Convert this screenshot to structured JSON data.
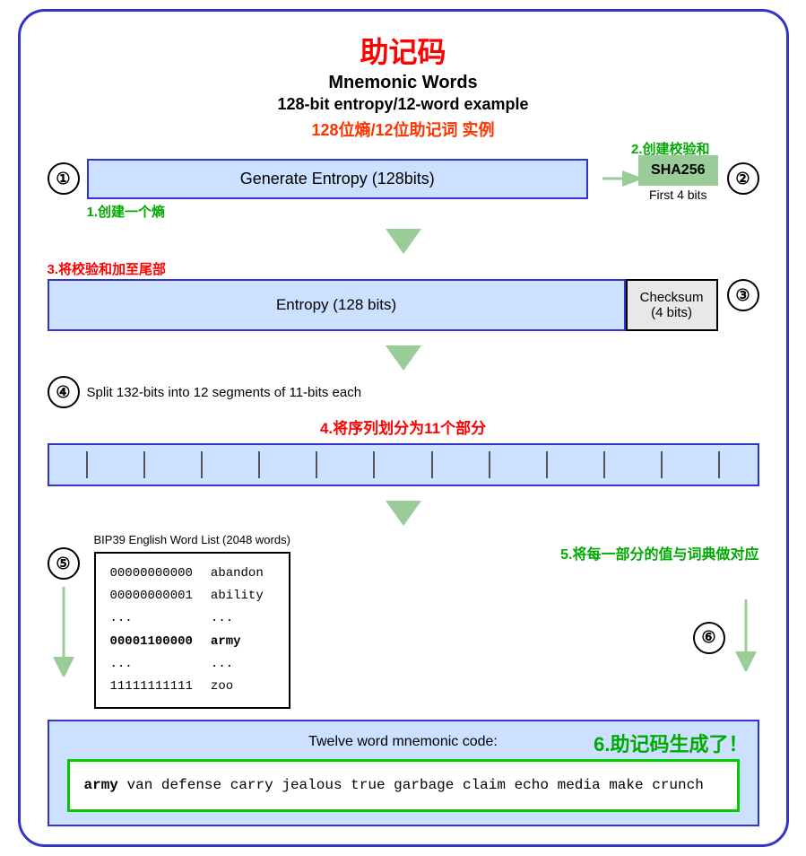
{
  "title": {
    "cn": "助记码",
    "en1": "Mnemonic Words",
    "en2": "128-bit entropy/12-word example",
    "cn2": "128位熵/12位助记词 实例"
  },
  "step1": {
    "num": "①",
    "entropy_label": "Generate Entropy (128bits)",
    "sha_label": "SHA256",
    "first4": "First 4 bits",
    "label1_cn": "1.创建一个熵",
    "label2_cn": "2.创建校验和"
  },
  "step3": {
    "label_cn": "3.将校验和加至尾部",
    "entropy_label": "Entropy (128 bits)",
    "checksum_label": "Checksum\n(4 bits)",
    "num": "③"
  },
  "step4": {
    "num": "④",
    "text": "Split 132-bits into 12 segments of 11-bits each",
    "cn": "4.将序列划分为11个部分"
  },
  "step5": {
    "num": "⑤",
    "wordlist_title": "BIP39 English Word List (2048 words)",
    "col1": [
      "00000000000",
      "00000000001",
      "...",
      "00001100000",
      "...",
      "11111111111"
    ],
    "col2": [
      "abandon",
      "ability",
      "...",
      "army",
      "...",
      "zoo"
    ],
    "cn": "5.将每一部分的值与词典做对应",
    "num6": "⑥"
  },
  "step6": {
    "label": "Twelve word mnemonic code:",
    "cn": "6.助记码生成了！",
    "mnemonic_first": "army",
    "mnemonic_rest": " van defense carry jealous true\n garbage claim echo media make crunch"
  }
}
